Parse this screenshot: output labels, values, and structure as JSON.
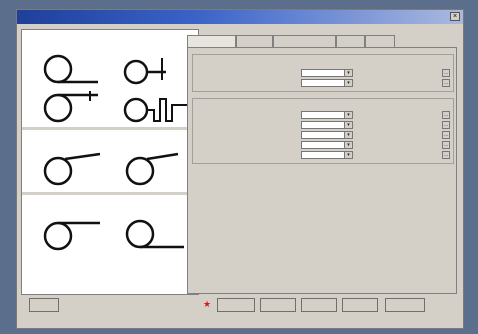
{
  "window": {
    "title": "",
    "close_glyph": "×"
  },
  "left_panel": {
    "sections": [
      {
        "title": "",
        "labels": [
          "",
          "",
          "",
          ""
        ]
      },
      {
        "title": "",
        "labels": [
          "",
          ""
        ]
      },
      {
        "title": "",
        "labels": [
          "",
          ""
        ]
      }
    ]
  },
  "tabs": [
    {
      "label": "",
      "active": true
    },
    {
      "label": "",
      "active": false
    },
    {
      "label": "",
      "active": false
    },
    {
      "label": "",
      "active": false
    },
    {
      "label": "",
      "active": false
    }
  ],
  "group1": {
    "title": "",
    "rows": [
      {
        "label": "",
        "value": ""
      },
      {
        "label": "",
        "value": ""
      }
    ]
  },
  "group2": {
    "title": "",
    "rows": [
      {
        "label": "",
        "value": ""
      },
      {
        "label": "",
        "value": ""
      },
      {
        "label": "",
        "value": ""
      },
      {
        "label": "",
        "value": ""
      },
      {
        "label": "",
        "value": ""
      }
    ]
  },
  "buttons": {
    "help": "",
    "default": "",
    "apply": "",
    "back": "",
    "next": "",
    "cancel": ""
  },
  "glyphs": {
    "dropdown_arrow": "▾",
    "side_button": "…"
  },
  "colors": {
    "title_bar": "#1f3f9a",
    "marker": "#d21c1c"
  }
}
